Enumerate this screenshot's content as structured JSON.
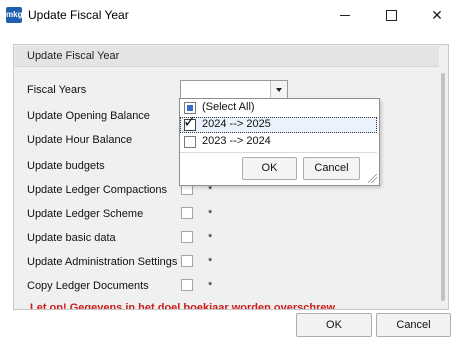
{
  "window": {
    "title": "Update Fiscal Year",
    "app_icon_text": "mkg",
    "close_glyph": "✕"
  },
  "group": {
    "title": "Update Fiscal Year"
  },
  "form": {
    "fiscal_years_label": "Fiscal Years",
    "rows": [
      {
        "label": "Update Opening Balance"
      },
      {
        "label": "Update Hour Balance"
      },
      {
        "label": "Update budgets"
      },
      {
        "label": "Update Ledger Compactions",
        "star": "*"
      },
      {
        "label": "Update Ledger Scheme",
        "star": "*"
      },
      {
        "label": "Update basic data",
        "star": "*"
      },
      {
        "label": "Update Administration Settings",
        "star": "*"
      },
      {
        "label": "Copy Ledger Documents",
        "star": "*"
      }
    ],
    "warning": "Let op! Gegevens in het doel boekjaar worden overschrew"
  },
  "dropdown": {
    "items": [
      {
        "label": "(Select All)",
        "state": "partial"
      },
      {
        "label": "2024 --> 2025",
        "state": "checked"
      },
      {
        "label": "2023 --> 2024",
        "state": "unchecked"
      }
    ],
    "ok_label": "OK",
    "cancel_label": "Cancel",
    "checkmark_glyph": "✓"
  },
  "footer": {
    "ok_label": "OK",
    "cancel_label": "Cancel"
  },
  "colors": {
    "warning": "#cc1b1b",
    "panel_bg": "#f0f0f0"
  }
}
